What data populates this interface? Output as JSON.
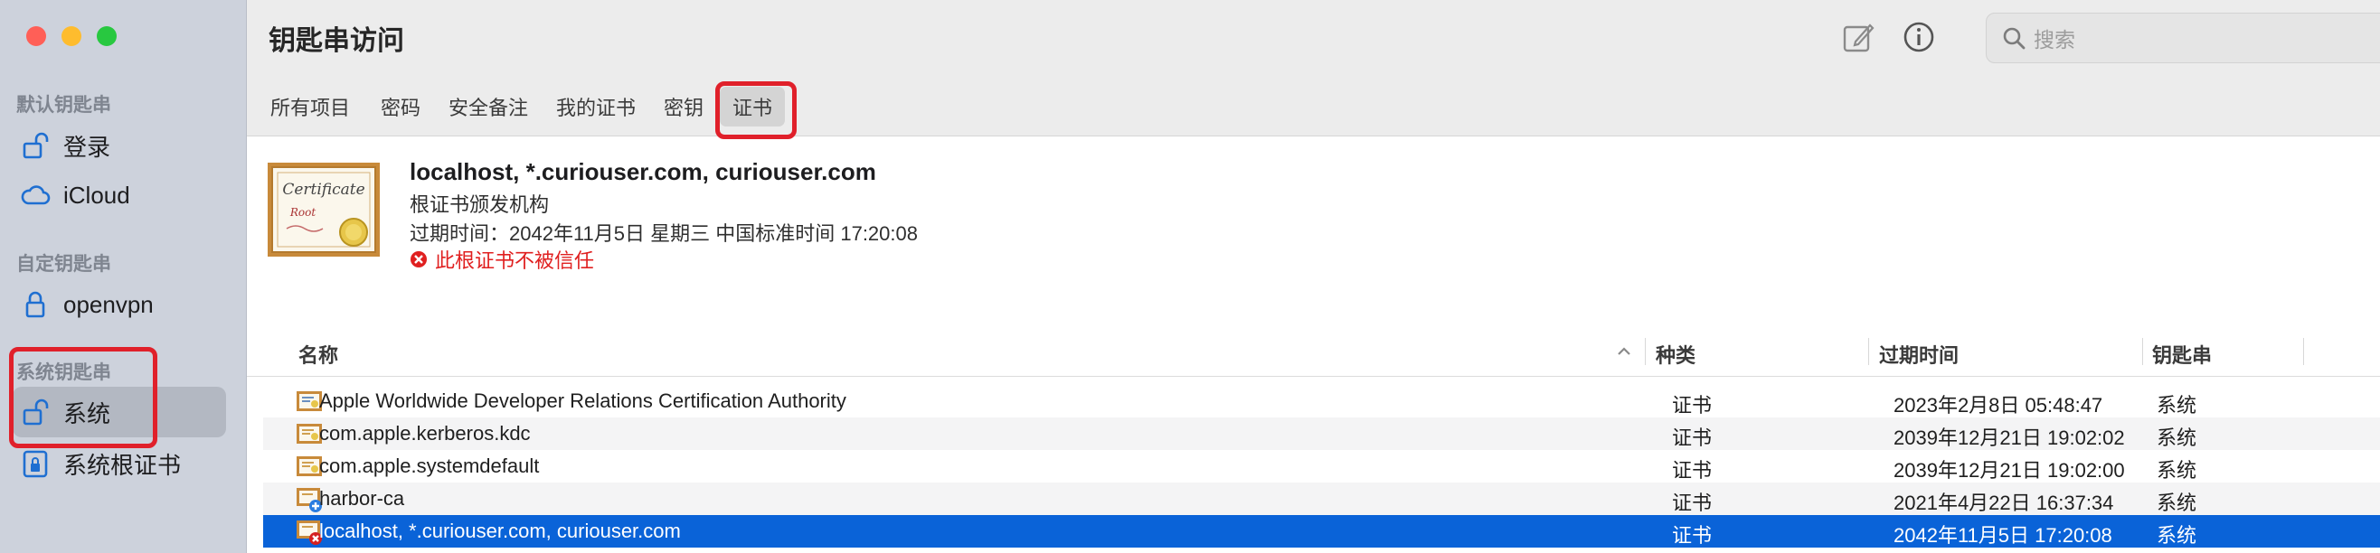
{
  "window": {
    "title": "钥匙串访问"
  },
  "colors": {
    "accent": "#0a63d8",
    "warning": "#e02020",
    "highlight_box": "#e0202a"
  },
  "sidebar": {
    "sections": [
      {
        "label": "默认钥匙串",
        "items": [
          {
            "label": "登录",
            "icon": "lock-open-icon"
          },
          {
            "label": "iCloud",
            "icon": "cloud-icon"
          }
        ]
      },
      {
        "label": "自定钥匙串",
        "items": [
          {
            "label": "openvpn",
            "icon": "lock-icon"
          }
        ]
      },
      {
        "label": "系统钥匙串",
        "items": [
          {
            "label": "系统",
            "icon": "lock-open-icon",
            "selected": true
          },
          {
            "label": "系统根证书",
            "icon": "lock-cabinet-icon"
          }
        ]
      }
    ]
  },
  "toolbar": {
    "compose_icon": "compose-icon",
    "info_icon": "info-icon",
    "search_placeholder": "搜索"
  },
  "tabs": [
    {
      "label": "所有项目"
    },
    {
      "label": "密码"
    },
    {
      "label": "安全备注"
    },
    {
      "label": "我的证书"
    },
    {
      "label": "密钥"
    },
    {
      "label": "证书",
      "active": true
    }
  ],
  "detail": {
    "icon": "certificate-root-icon",
    "name": "localhost, *.curiouser.com, curiouser.com",
    "kind": "根证书颁发机构",
    "expires": "过期时间：2042年11月5日 星期三 中国标准时间 17:20:08",
    "warning": "此根证书不被信任"
  },
  "table": {
    "columns": [
      "名称",
      "种类",
      "过期时间",
      "钥匙串"
    ],
    "rows": [
      {
        "name": "Apple Worldwide Developer Relations Certification Authority",
        "kind": "证书",
        "expires": "2023年2月8日 05:48:47",
        "keychain": "系统",
        "icon": "certificate-icon"
      },
      {
        "name": "com.apple.kerberos.kdc",
        "kind": "证书",
        "expires": "2039年12月21日 19:02:02",
        "keychain": "系统",
        "icon": "certificate-icon"
      },
      {
        "name": "com.apple.systemdefault",
        "kind": "证书",
        "expires": "2039年12月21日 19:02:00",
        "keychain": "系统",
        "icon": "certificate-icon"
      },
      {
        "name": "harbor-ca",
        "kind": "证书",
        "expires": "2021年4月22日 16:37:34",
        "keychain": "系统",
        "icon": "certificate-trusted-icon"
      },
      {
        "name": "localhost, *.curiouser.com, curiouser.com",
        "kind": "证书",
        "expires": "2042年11月5日 17:20:08",
        "keychain": "系统",
        "icon": "certificate-untrusted-icon",
        "selected": true
      }
    ]
  }
}
